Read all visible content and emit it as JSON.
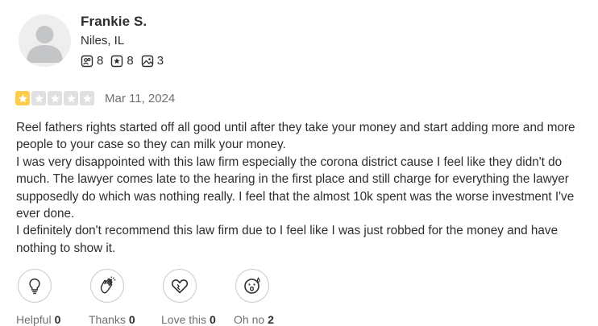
{
  "user": {
    "name": "Frankie S.",
    "location": "Niles, IL",
    "stats": {
      "friends": "8",
      "reviews": "8",
      "photos": "3"
    }
  },
  "review": {
    "rating": 1,
    "max_rating": 5,
    "date": "Mar 11, 2024",
    "paragraphs": [
      "Reel fathers rights started off all good until after they take your money and start adding more and more people to your case so they can milk your money.",
      "I was very disappointed with this law firm especially the corona district cause I feel like they didn't do much. The lawyer comes late to the hearing in the first place and still charge for everything the lawyer supposedly do which was nothing really. I feel that the almost 10k spent was the worse investment I've ever done.",
      "I definitely don't recommend this law firm due to I feel like I was just robbed for the money and have nothing to show it."
    ]
  },
  "reactions": [
    {
      "label": "Helpful",
      "count": "0",
      "icon": "lightbulb-icon"
    },
    {
      "label": "Thanks",
      "count": "0",
      "icon": "clapping-hands-icon"
    },
    {
      "label": "Love this",
      "count": "0",
      "icon": "heart-icon"
    },
    {
      "label": "Oh no",
      "count": "2",
      "icon": "shocked-face-icon"
    }
  ],
  "colors": {
    "star_on": "#ffcc4b",
    "star_off": "#e0e0e0",
    "text": "#2d2e2f",
    "muted": "#6e7072"
  }
}
